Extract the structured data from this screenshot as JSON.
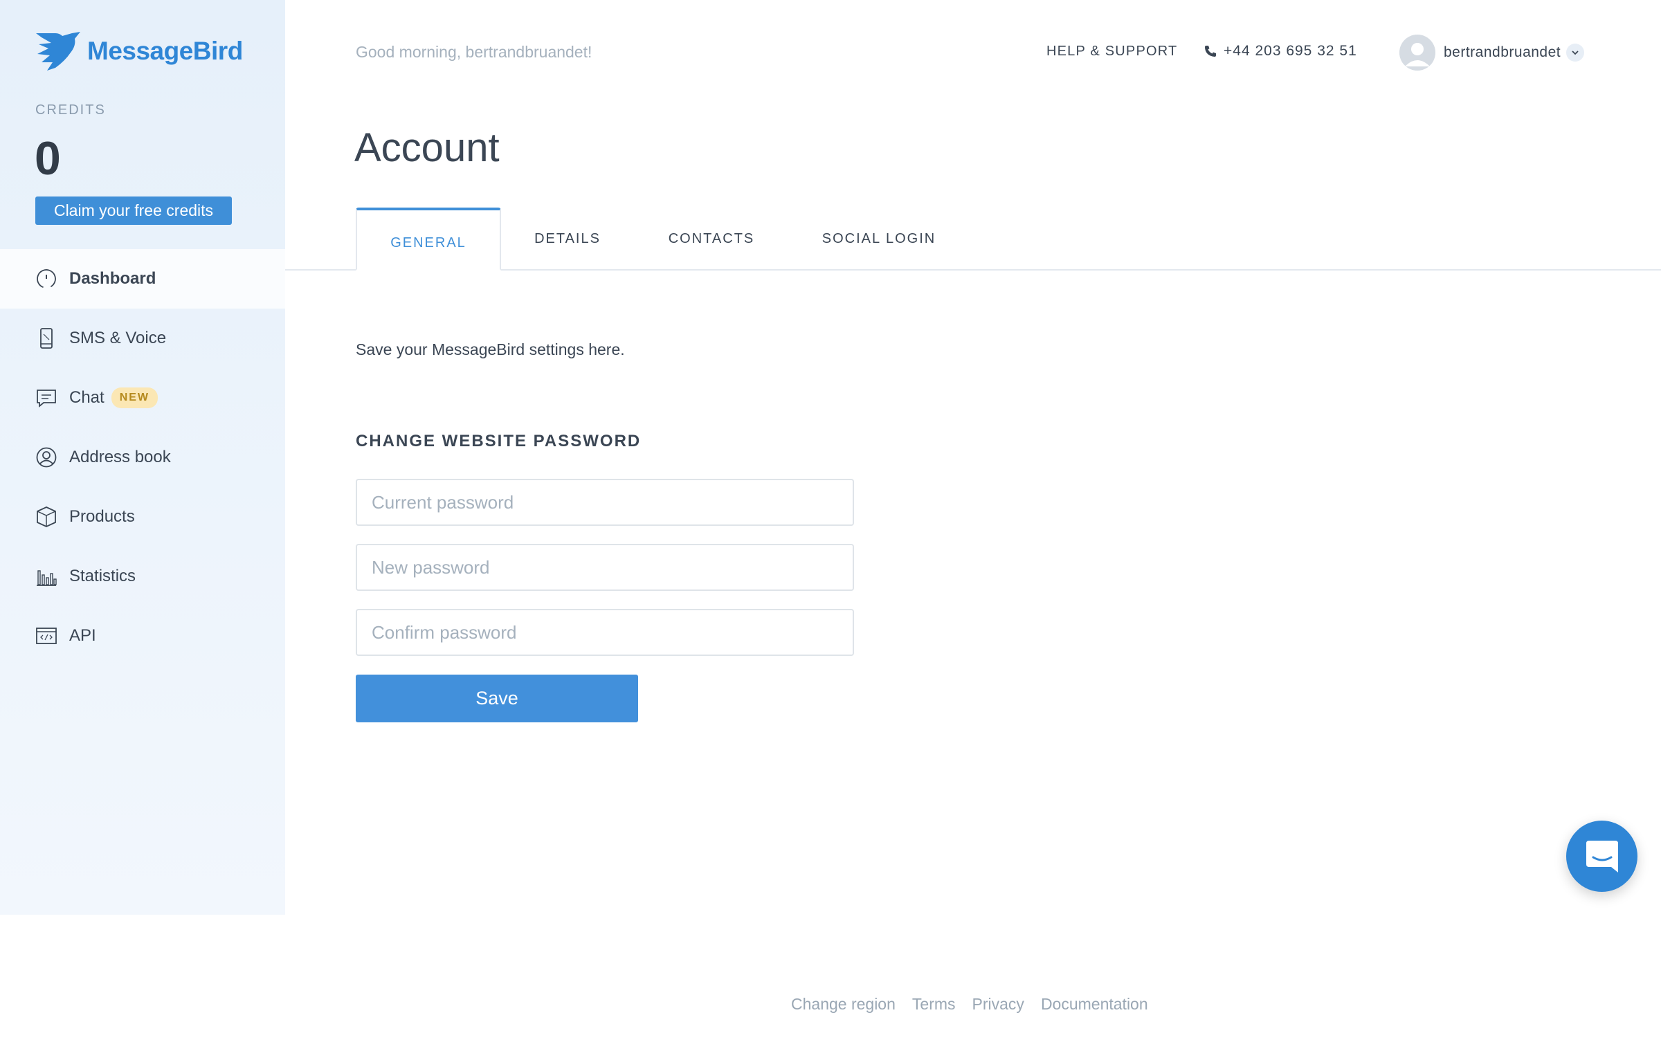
{
  "brand": {
    "name": "MessageBird",
    "color": "#2f86d6"
  },
  "sidebar": {
    "credits_label": "CREDITS",
    "credits_value": "0",
    "claim_button": "Claim your free credits",
    "items": [
      {
        "label": "Dashboard",
        "icon": "speedometer-icon",
        "active": true
      },
      {
        "label": "SMS & Voice",
        "icon": "phone-device-icon"
      },
      {
        "label": "Chat",
        "icon": "chat-icon",
        "badge": "NEW"
      },
      {
        "label": "Address book",
        "icon": "contact-icon"
      },
      {
        "label": "Products",
        "icon": "box-icon"
      },
      {
        "label": "Statistics",
        "icon": "bar-chart-icon"
      },
      {
        "label": "API",
        "icon": "code-window-icon"
      }
    ]
  },
  "header": {
    "greeting": "Good morning, bertrandbruandet!",
    "help": "HELP & SUPPORT",
    "phone": "+44 203 695 32 51",
    "username": "bertrandbruandet"
  },
  "main": {
    "title": "Account",
    "tabs": [
      {
        "label": "GENERAL",
        "active": true
      },
      {
        "label": "DETAILS"
      },
      {
        "label": "CONTACTS"
      },
      {
        "label": "SOCIAL LOGIN"
      }
    ],
    "intro": "Save your MessageBird settings here.",
    "section_title": "CHANGE WEBSITE PASSWORD",
    "fields": {
      "current": {
        "placeholder": "Current password",
        "value": ""
      },
      "new": {
        "placeholder": "New password",
        "value": ""
      },
      "confirm": {
        "placeholder": "Confirm password",
        "value": ""
      }
    },
    "save_label": "Save"
  },
  "footer": {
    "links": [
      "Change region",
      "Terms",
      "Privacy",
      "Documentation"
    ]
  },
  "colors": {
    "accent": "#3f8fd8",
    "sidebar_bg": "#e6f0fa",
    "badge_bg": "#fbe7b4"
  }
}
